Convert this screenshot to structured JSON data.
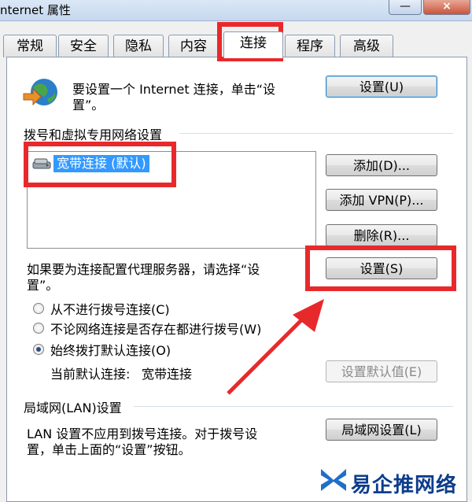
{
  "window": {
    "title": "nternet 属性",
    "min_icon": "—",
    "close_icon": "×"
  },
  "tabs": [
    {
      "label": "常规"
    },
    {
      "label": "安全"
    },
    {
      "label": "隐私"
    },
    {
      "label": "内容"
    },
    {
      "label": "连接",
      "active": true
    },
    {
      "label": "程序"
    },
    {
      "label": "高级"
    }
  ],
  "setup": {
    "text_line1": "要设置一个 Internet 连接，单击“设",
    "text_line2": "置”。",
    "button": "设置(U)",
    "icon": "globe-network-icon"
  },
  "dialup": {
    "section": "拨号和虚拟专用网络设置",
    "items": [
      {
        "label": "宽带连接 (默认)",
        "icon": "modem-icon"
      }
    ],
    "add": "添加(D)...",
    "add_vpn": "添加 VPN(P)...",
    "remove": "删除(R)...",
    "proxy_line1": "如果要为连接配置代理服务器，请选择“设",
    "proxy_line2": "置”。",
    "settings": "设置(S)",
    "radios": [
      {
        "label": "从不进行拨号连接(C)",
        "checked": false
      },
      {
        "label": "不论网络连接是否存在都进行拨号(W)",
        "checked": false
      },
      {
        "label": "始终拨打默认连接(O)",
        "checked": true
      }
    ],
    "current_default_label": "当前默认连接:",
    "current_default_value": "宽带连接",
    "set_default": "设置默认值(E)"
  },
  "lan": {
    "section": "局域网(LAN)设置",
    "text_line1": "LAN 设置不应用到拨号连接。对于拨号设",
    "text_line2": "置，单击上面的“设置”按钮。",
    "button": "局域网设置(L)"
  },
  "watermark": {
    "text": "易企推网络"
  },
  "colors": {
    "highlight": "#e8292c",
    "selection": "#3399ff",
    "accent_blue": "#0d3d8c"
  }
}
